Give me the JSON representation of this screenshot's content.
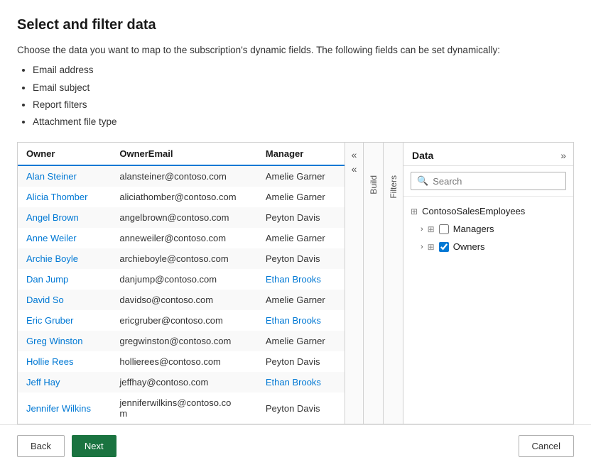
{
  "page": {
    "title": "Select and filter data",
    "description": "Choose the data you want to map to the subscription's dynamic fields. The following fields can be set dynamically:",
    "dynamic_fields": [
      "Email address",
      "Email subject",
      "Report filters",
      "Attachment file type"
    ]
  },
  "table": {
    "columns": [
      "Owner",
      "OwnerEmail",
      "Manager"
    ],
    "rows": [
      {
        "owner": "Alan Steiner",
        "email": "alansteiner@contoso.com",
        "manager": "Amelie Garner"
      },
      {
        "owner": "Alicia Thomber",
        "email": "aliciathomber@contoso.com",
        "manager": "Amelie Garner"
      },
      {
        "owner": "Angel Brown",
        "email": "angelbrown@contoso.com",
        "manager": "Peyton Davis"
      },
      {
        "owner": "Anne Weiler",
        "email": "anneweiler@contoso.com",
        "manager": "Amelie Garner"
      },
      {
        "owner": "Archie Boyle",
        "email": "archieboyle@contoso.com",
        "manager": "Peyton Davis"
      },
      {
        "owner": "Dan Jump",
        "email": "danjump@contoso.com",
        "manager": "Ethan Brooks"
      },
      {
        "owner": "David So",
        "email": "davidso@contoso.com",
        "manager": "Amelie Garner"
      },
      {
        "owner": "Eric Gruber",
        "email": "ericgruber@contoso.com",
        "manager": "Ethan Brooks"
      },
      {
        "owner": "Greg Winston",
        "email": "gregwinston@contoso.com",
        "manager": "Amelie Garner"
      },
      {
        "owner": "Hollie Rees",
        "email": "hollierees@contoso.com",
        "manager": "Peyton Davis"
      },
      {
        "owner": "Jeff Hay",
        "email": "jeffhay@contoso.com",
        "manager": "Ethan Brooks"
      },
      {
        "owner": "Jennifer Wilkins",
        "email": "jenniferwilkins@contoso.co\nm",
        "manager": "Peyton Davis"
      }
    ]
  },
  "side_tabs": {
    "build_label": "Build",
    "filters_label": "Filters"
  },
  "chevrons": {
    "left1": "«",
    "left2": "«",
    "right": "»"
  },
  "right_panel": {
    "title": "Data",
    "search_placeholder": "Search",
    "tree": {
      "root": "ContosoSalesEmployees",
      "children": [
        {
          "label": "Managers",
          "checked": false
        },
        {
          "label": "Owners",
          "checked": true
        }
      ]
    }
  },
  "footer": {
    "back_label": "Back",
    "next_label": "Next",
    "cancel_label": "Cancel"
  }
}
